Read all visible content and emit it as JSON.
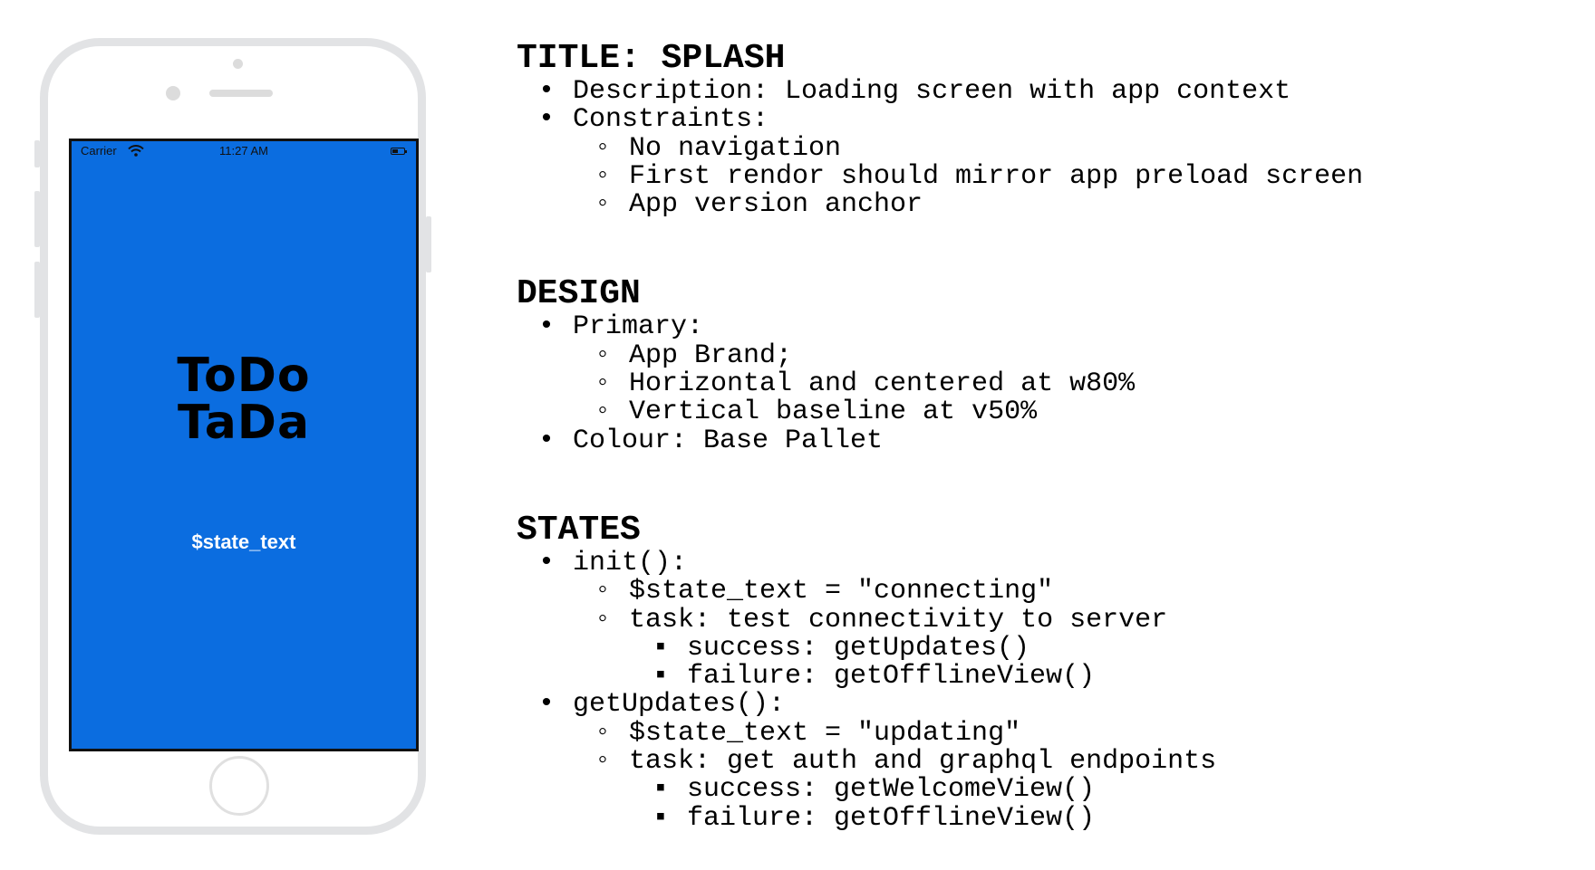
{
  "phone": {
    "status_bar": {
      "carrier": "Carrier",
      "time": "11:27 AM",
      "wifi_icon": "wifi-icon",
      "battery_icon": "battery-icon"
    },
    "brand_lines": [
      "ToDo",
      "TaDa"
    ],
    "state_text": "$state_text",
    "colors": {
      "screen": "#0b6de0",
      "frame": "#e2e3e5",
      "state_text": "#ffffff",
      "brand": "#000000"
    }
  },
  "spec": {
    "title": {
      "heading": "TITLE: SPLASH",
      "items": [
        "Description: Loading screen with app context",
        "Constraints:"
      ],
      "constraints": [
        "No navigation",
        "First rendor should mirror app preload screen",
        "App version anchor"
      ]
    },
    "design": {
      "heading": "DESIGN",
      "primary_label": "Primary:",
      "primary": [
        "App Brand;",
        "Horizontal and centered at w80%",
        "Vertical baseline at v50%"
      ],
      "colour": "Colour: Base Pallet"
    },
    "states": {
      "heading": "STATES",
      "init": {
        "label": "init():",
        "items": [
          "$state_text = \"connecting\"",
          "task: test connectivity to server"
        ],
        "outcomes": [
          "success: getUpdates()",
          "failure: getOfflineView()"
        ]
      },
      "get_updates": {
        "label": "getUpdates():",
        "items": [
          "$state_text = \"updating\"",
          "task: get auth and graphql endpoints"
        ],
        "outcomes": [
          "success: getWelcomeView()",
          "failure: getOfflineView()"
        ]
      }
    },
    "bullets": {
      "level1": "•",
      "level2": "◦",
      "level3": "▪"
    }
  }
}
